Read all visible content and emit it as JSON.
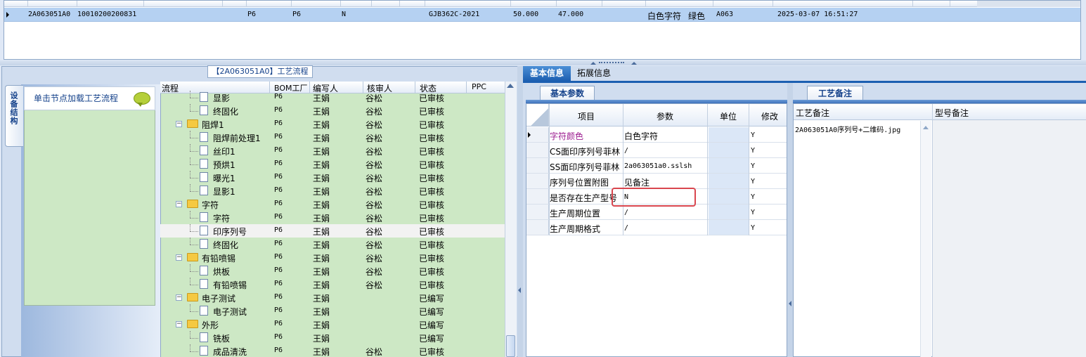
{
  "top_grid": {
    "row": {
      "code": "2A063051A0",
      "number": "10010200200831",
      "factory1": "P6",
      "factory2": "P6",
      "flag": "N",
      "standard": "GJB362C-2021",
      "value1": "50.000",
      "value2": "47.000",
      "char_color": "白色字符",
      "color": "绿色",
      "code2": "A063",
      "datetime": "2025-03-07 16:51:27"
    }
  },
  "process_panel": {
    "title": "【2A063051A0】工艺流程",
    "side_tab": "设备结构",
    "hint": "单击节点加载工艺流程",
    "columns": [
      "流程",
      "BOM工厂",
      "编写人",
      "核审人",
      "状态",
      "PPC"
    ],
    "rows": [
      {
        "level": 2,
        "kind": "doc",
        "name": "显影",
        "bom": "P6",
        "writer": "王娟",
        "reviewer": "谷松",
        "status": "已审核"
      },
      {
        "level": 2,
        "kind": "doc",
        "name": "终固化",
        "bom": "P6",
        "writer": "王娟",
        "reviewer": "谷松",
        "status": "已审核"
      },
      {
        "level": 1,
        "kind": "folder",
        "name": "阻焊1",
        "bom": "P6",
        "writer": "王娟",
        "reviewer": "谷松",
        "status": "已审核"
      },
      {
        "level": 2,
        "kind": "doc",
        "name": "阻焊前处理1",
        "bom": "P6",
        "writer": "王娟",
        "reviewer": "谷松",
        "status": "已审核"
      },
      {
        "level": 2,
        "kind": "doc",
        "name": "丝印1",
        "bom": "P6",
        "writer": "王娟",
        "reviewer": "谷松",
        "status": "已审核"
      },
      {
        "level": 2,
        "kind": "doc",
        "name": "预烘1",
        "bom": "P6",
        "writer": "王娟",
        "reviewer": "谷松",
        "status": "已审核"
      },
      {
        "level": 2,
        "kind": "doc",
        "name": "曝光1",
        "bom": "P6",
        "writer": "王娟",
        "reviewer": "谷松",
        "status": "已审核"
      },
      {
        "level": 2,
        "kind": "doc",
        "name": "显影1",
        "bom": "P6",
        "writer": "王娟",
        "reviewer": "谷松",
        "status": "已审核"
      },
      {
        "level": 1,
        "kind": "folder",
        "name": "字符",
        "bom": "P6",
        "writer": "王娟",
        "reviewer": "谷松",
        "status": "已审核"
      },
      {
        "level": 2,
        "kind": "doc",
        "name": "字符",
        "bom": "P6",
        "writer": "王娟",
        "reviewer": "谷松",
        "status": "已审核"
      },
      {
        "level": 2,
        "kind": "doc",
        "name": "印序列号",
        "bom": "P6",
        "writer": "王娟",
        "reviewer": "谷松",
        "status": "已审核",
        "selected": true
      },
      {
        "level": 2,
        "kind": "doc",
        "name": "终固化",
        "bom": "P6",
        "writer": "王娟",
        "reviewer": "谷松",
        "status": "已审核"
      },
      {
        "level": 1,
        "kind": "folder",
        "name": "有铅喷锡",
        "bom": "P6",
        "writer": "王娟",
        "reviewer": "谷松",
        "status": "已审核"
      },
      {
        "level": 2,
        "kind": "doc",
        "name": "烘板",
        "bom": "P6",
        "writer": "王娟",
        "reviewer": "谷松",
        "status": "已审核"
      },
      {
        "level": 2,
        "kind": "doc",
        "name": "有铅喷锡",
        "bom": "P6",
        "writer": "王娟",
        "reviewer": "谷松",
        "status": "已审核"
      },
      {
        "level": 1,
        "kind": "folder",
        "name": "电子测试",
        "bom": "P6",
        "writer": "王娟",
        "reviewer": "",
        "status": "已编写"
      },
      {
        "level": 2,
        "kind": "doc",
        "name": "电子测试",
        "bom": "P6",
        "writer": "王娟",
        "reviewer": "",
        "status": "已编写"
      },
      {
        "level": 1,
        "kind": "folder",
        "name": "外形",
        "bom": "P6",
        "writer": "王娟",
        "reviewer": "",
        "status": "已编写"
      },
      {
        "level": 2,
        "kind": "doc",
        "name": "铣板",
        "bom": "P6",
        "writer": "王娟",
        "reviewer": "",
        "status": "已编写"
      },
      {
        "level": 2,
        "kind": "doc",
        "name": "成品清洗",
        "bom": "P6",
        "writer": "王娟",
        "reviewer": "谷松",
        "status": "已审核"
      }
    ]
  },
  "right_panel": {
    "tabs": [
      "基本信息",
      "拓展信息"
    ],
    "basic_params_tab": "基本参数",
    "param_columns": [
      "项目",
      "参数",
      "单位",
      "修改"
    ],
    "params": [
      {
        "item": "字符颜色",
        "value": "白色字符",
        "unit": "",
        "modify": "Y",
        "current": true
      },
      {
        "item": "CS面印序列号菲林",
        "value": "/",
        "unit": "",
        "modify": "Y"
      },
      {
        "item": "SS面印序列号菲林",
        "value": "2a063051a0.sslsh",
        "unit": "",
        "modify": "Y"
      },
      {
        "item": "序列号位置附图",
        "value": "见备注",
        "unit": "",
        "modify": "Y"
      },
      {
        "item": "是否存在生产型号",
        "value": "N",
        "unit": "",
        "modify": "Y"
      },
      {
        "item": "生产周期位置",
        "value": "/",
        "unit": "",
        "modify": "Y"
      },
      {
        "item": "生产周期格式",
        "value": "/",
        "unit": "",
        "modify": "Y"
      }
    ],
    "remarks_tab": "工艺备注",
    "remarks_columns": [
      "工艺备注",
      "型号备注"
    ],
    "remark_value": "2A063051A0序列号+二维码.jpg"
  }
}
